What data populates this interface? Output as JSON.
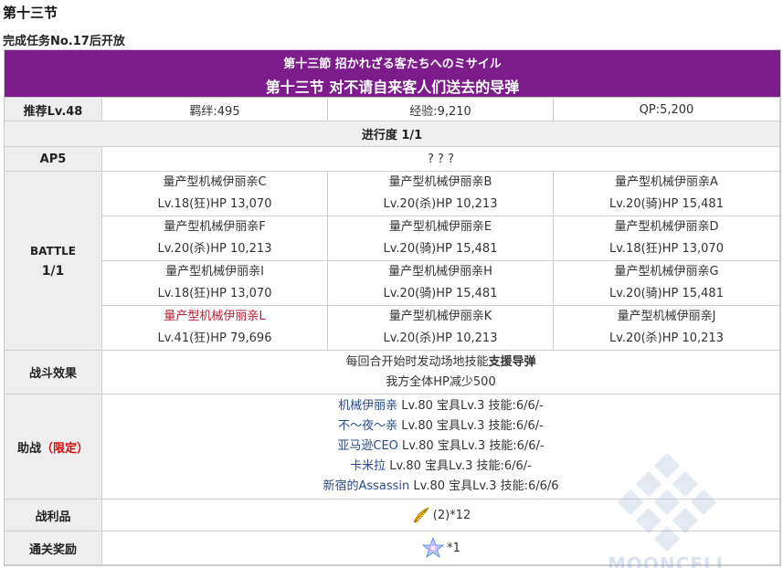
{
  "section": {
    "title": "第十三节",
    "subtitle": "完成任务No.17后开放"
  },
  "quest": {
    "title_jp": "第十三節 招かれざる客たちへのミサイル",
    "title_cn": "第十三节 对不请自来客人们送去的导弹",
    "recommend": "推荐Lv.48",
    "bond": "羁绊:495",
    "exp": "经验:9,210",
    "qp": "QP:5,200",
    "progress": "进行度 1/1",
    "ap": "AP5",
    "phase_name": "? ? ?",
    "battle_label": "BATTLE",
    "battle_count": "1/1",
    "enemies": [
      [
        {
          "name": "量产型机械伊丽亲C",
          "stats": "Lv.18(狂)HP 13,070"
        },
        {
          "name": "量产型机械伊丽亲B",
          "stats": "Lv.20(杀)HP 10,213"
        },
        {
          "name": "量产型机械伊丽亲A",
          "stats": "Lv.20(骑)HP 15,481"
        }
      ],
      [
        {
          "name": "量产型机械伊丽亲F",
          "stats": "Lv.20(杀)HP 10,213"
        },
        {
          "name": "量产型机械伊丽亲E",
          "stats": "Lv.20(骑)HP 15,481"
        },
        {
          "name": "量产型机械伊丽亲D",
          "stats": "Lv.18(狂)HP 13,070"
        }
      ],
      [
        {
          "name": "量产型机械伊丽亲I",
          "stats": "Lv.18(狂)HP 13,070"
        },
        {
          "name": "量产型机械伊丽亲H",
          "stats": "Lv.20(骑)HP 15,481"
        },
        {
          "name": "量产型机械伊丽亲G",
          "stats": "Lv.20(骑)HP 15,481"
        }
      ],
      [
        {
          "name": "量产型机械伊丽亲L",
          "stats": "Lv.41(狂)HP 79,696"
        },
        {
          "name": "量产型机械伊丽亲K",
          "stats": "Lv.20(杀)HP 10,213"
        },
        {
          "name": "量产型机械伊丽亲J",
          "stats": "Lv.20(杀)HP 10,213"
        }
      ]
    ],
    "effect_label": "战斗效果",
    "effect_line1_pre": "每回合开始时发动场地技能",
    "effect_line1_skill": "支援导弹",
    "effect_line2": "我方全体HP减少500",
    "support_label": "助战",
    "support_limited": "（限定）",
    "supports": [
      {
        "name": "机械伊丽亲",
        "info": " Lv.80 宝具Lv.3 技能:6/6/-"
      },
      {
        "name": "不～夜～亲",
        "info": " Lv.80 宝具Lv.3 技能:6/6/-"
      },
      {
        "name": "亚马逊CEO",
        "info": " Lv.80 宝具Lv.3 技能:6/6/-"
      },
      {
        "name": "卡米拉",
        "info": " Lv.80 宝具Lv.3 技能:6/6/-"
      },
      {
        "name": "新宿的Assassin",
        "info": " Lv.80 宝具Lv.3 技能:6/6/6"
      }
    ],
    "drops_label": "战利品",
    "drops": "(2)*12",
    "reward_label": "通关奖励",
    "reward": "*1",
    "watermark": "MOONCELL"
  },
  "colors": {
    "header_bg": "#7d1d8c",
    "highlight_enemy": "#b22234",
    "limited": "#d01010",
    "support_name": "#2a4a8a"
  },
  "icons": {
    "drop": "gold-feather-icon",
    "reward": "saint-quartz-icon"
  }
}
